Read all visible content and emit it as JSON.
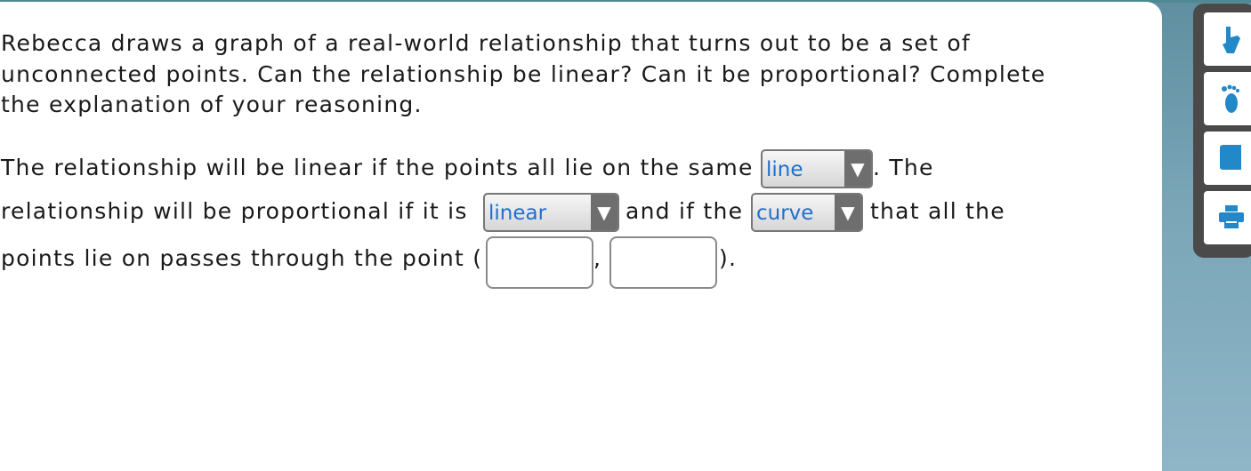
{
  "question": {
    "text": "Rebecca draws a graph of a real-world relationship that turns out to be a set of unconnected points. Can the relationship be linear? Can it be proportional? Complete the explanation of your reasoning."
  },
  "answer": {
    "seg1": "The relationship will be linear if the points all lie on the same",
    "dropdown1": {
      "value": "line",
      "arrow": "▼"
    },
    "seg2": ". The",
    "seg3": "relationship will be proportional if it is",
    "dropdown2": {
      "value": "linear",
      "arrow": "▼"
    },
    "seg4": "and if the",
    "dropdown3": {
      "value": "curve",
      "arrow": "▼"
    },
    "seg5": "that all the",
    "seg6": "points lie on passes through the point (",
    "blank1": {
      "value": "",
      "placeholder": ""
    },
    "comma": ",",
    "blank2": {
      "value": "",
      "placeholder": ""
    },
    "seg7": ")."
  },
  "toolbar": {
    "tools": [
      {
        "icon": "hand-pointer-icon"
      },
      {
        "icon": "footprint-icon"
      },
      {
        "icon": "book-icon"
      },
      {
        "icon": "printer-icon"
      }
    ]
  },
  "colors": {
    "dropdown_text": "#1f6fcf",
    "tool_icon": "#2388c8",
    "background": "#7aa6b8"
  }
}
